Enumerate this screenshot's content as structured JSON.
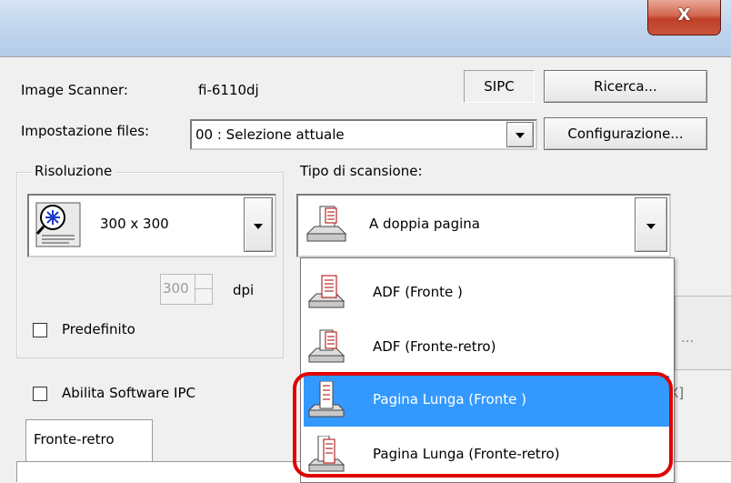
{
  "window": {
    "close_glyph": "X"
  },
  "scanner": {
    "label": "Image Scanner:",
    "value": "fi-6110dj",
    "sipc": "SIPC",
    "search_button": "Ricerca..."
  },
  "settings": {
    "label": "Impostazione files:",
    "value": "00 : Selezione attuale",
    "config_button": "Configurazione..."
  },
  "resolution": {
    "group_label": "Risoluzione",
    "value": "300 x 300",
    "dpi_value": "300",
    "dpi_unit": "dpi",
    "default_label": "Predefinito"
  },
  "scan_type": {
    "label": "Tipo di scansione:",
    "selected": "A doppia pagina",
    "options": [
      "ADF (Fronte )",
      "ADF (Fronte-retro)",
      "Pagina Lunga (Fronte )",
      "Pagina Lunga (Fronte-retro)"
    ],
    "highlighted_option": "Pagina Lunga (Fronte )"
  },
  "ipc": {
    "label": "Abilita Software IPC"
  },
  "tabs": {
    "front_back": "Fronte-retro"
  },
  "partial": {
    "ellipsis": "...",
    "x_fragment": "X]"
  },
  "colors": {
    "highlight": "#3399ff",
    "annotation": "#e00000",
    "close_button": "#c9553b"
  }
}
